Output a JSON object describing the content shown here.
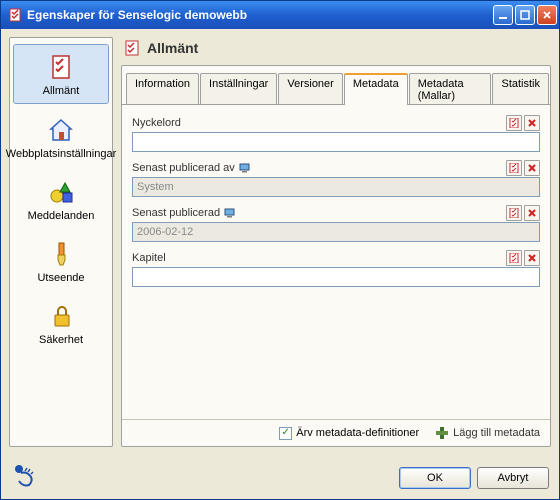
{
  "window": {
    "title": "Egenskaper för Senselogic demowebb"
  },
  "sidebar": {
    "items": [
      {
        "label": "Allmänt"
      },
      {
        "label": "Webbplatsinställningar"
      },
      {
        "label": "Meddelanden"
      },
      {
        "label": "Utseende"
      },
      {
        "label": "Säkerhet"
      }
    ]
  },
  "header": {
    "title": "Allmänt"
  },
  "tabs": [
    {
      "label": "Information"
    },
    {
      "label": "Inställningar"
    },
    {
      "label": "Versioner"
    },
    {
      "label": "Metadata"
    },
    {
      "label": "Metadata (Mallar)"
    },
    {
      "label": "Statistik"
    }
  ],
  "fields": {
    "nyckelord": {
      "label": "Nyckelord",
      "value": ""
    },
    "senast_pub_av": {
      "label": "Senast publicerad av",
      "value": "System"
    },
    "senast_pub": {
      "label": "Senast publicerad",
      "value": "2006-02-12"
    },
    "kapitel": {
      "label": "Kapitel",
      "value": ""
    }
  },
  "panelFooter": {
    "inherit": "Ärv metadata-definitioner",
    "add": "Lägg till metadata"
  },
  "buttons": {
    "ok": "OK",
    "cancel": "Avbryt"
  }
}
